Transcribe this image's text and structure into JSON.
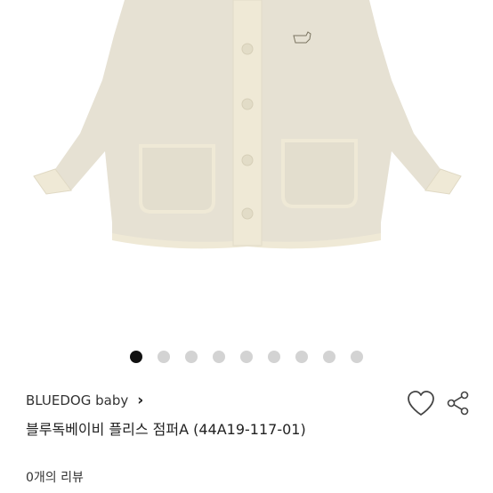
{
  "carousel": {
    "count": 9,
    "active_index": 0
  },
  "product": {
    "brand": "BLUEDOG baby",
    "title": "블루독베이비 플리스 점퍼A (44A19-117-01)",
    "review_count_text": "0개의 리뷰"
  },
  "icons": {
    "brand_chevron": "chevron-right-icon",
    "wishlist": "heart-outline-icon",
    "share": "share-icon"
  },
  "colors": {
    "jacket": "#e6e1d3",
    "trim": "#efe9d6",
    "dot_active": "#111111",
    "dot_inactive": "#d3d3d3"
  }
}
